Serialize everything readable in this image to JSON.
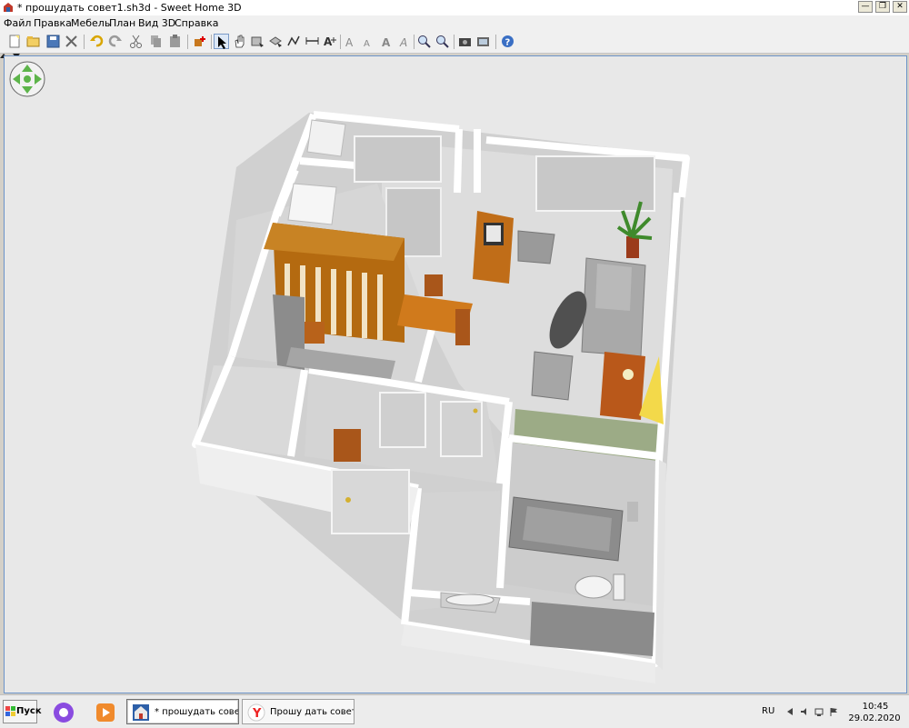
{
  "window": {
    "title": "* прошудать совет1.sh3d - Sweet Home 3D",
    "minimize_glyph": "—",
    "restore_glyph": "❐",
    "close_glyph": "✕"
  },
  "menu": [
    {
      "label": "Файл"
    },
    {
      "label": "Правка"
    },
    {
      "label": "Мебель"
    },
    {
      "label": "План"
    },
    {
      "label": "Вид 3D"
    },
    {
      "label": "Справка"
    }
  ],
  "toolbar": [
    {
      "name": "new-home-icon"
    },
    {
      "name": "open-icon"
    },
    {
      "name": "save-icon"
    },
    {
      "name": "cut-tool-icon"
    },
    {
      "name": "undo-icon"
    },
    {
      "name": "redo-icon"
    },
    {
      "name": "cut-icon"
    },
    {
      "name": "copy-icon"
    },
    {
      "name": "paste-icon"
    },
    {
      "name": "add-furniture-icon"
    },
    {
      "name": "select-mode-icon"
    },
    {
      "name": "pan-mode-icon"
    },
    {
      "name": "create-walls-icon"
    },
    {
      "name": "create-rooms-icon"
    },
    {
      "name": "create-polylines-icon"
    },
    {
      "name": "create-dimensions-icon"
    },
    {
      "name": "add-text-icon"
    },
    {
      "name": "text-increase-icon"
    },
    {
      "name": "text-decrease-icon"
    },
    {
      "name": "text-bold-icon"
    },
    {
      "name": "text-italic-icon"
    },
    {
      "name": "zoom-in-icon"
    },
    {
      "name": "zoom-out-icon"
    },
    {
      "name": "create-photo-icon"
    },
    {
      "name": "create-video-icon"
    },
    {
      "name": "help-icon"
    }
  ],
  "taskbar": {
    "start_label": "Пуск",
    "items": [
      {
        "label": "* прошудать совет..."
      },
      {
        "label": "Прошу дать совето..."
      }
    ],
    "language": "RU",
    "time": "10:45",
    "date": "29.02.2020"
  },
  "colors": {
    "viewport_bg": "#e8e8e8",
    "wall": "#ffffff",
    "floor": "#d8d8d8",
    "furniture_wood": "#c8781e",
    "accent_green": "#9cab86",
    "nav_arrow": "#5db44a"
  }
}
